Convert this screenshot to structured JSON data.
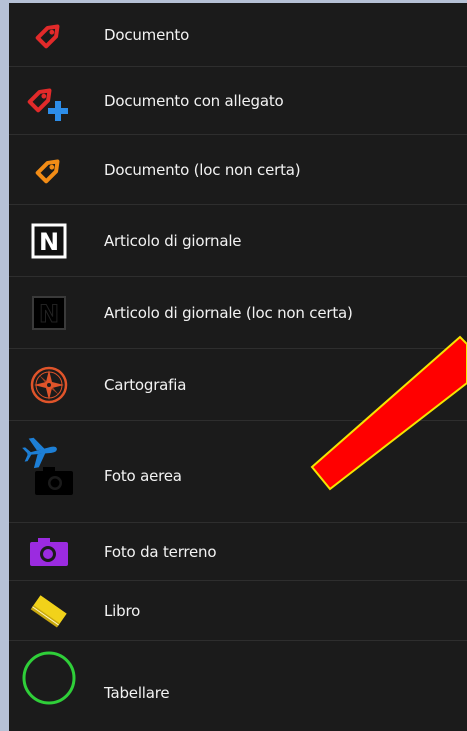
{
  "legend": {
    "items": [
      {
        "label": "Documento",
        "icon": "red-tag-icon",
        "color": "#e22a2a"
      },
      {
        "label": "Documento con allegato",
        "icon": "red-tag-plus-icon",
        "color": "#e22a2a"
      },
      {
        "label": "Documento (loc non certa)",
        "icon": "orange-tag-icon",
        "color": "#f28c16"
      },
      {
        "label": "Articolo di giornale",
        "icon": "newspaper-n-icon",
        "color": "#ffffff"
      },
      {
        "label": "Articolo di giornale (loc non certa)",
        "icon": "newspaper-n-dark-icon",
        "color": "#000000"
      },
      {
        "label": "Cartografia",
        "icon": "compass-rose-icon",
        "color": "#e0542a"
      },
      {
        "label": "Foto aerea",
        "icon": "airplane-camera-icon",
        "color": "#1d7fd6"
      },
      {
        "label": "Foto da terreno",
        "icon": "purple-camera-icon",
        "color": "#9b2be0"
      },
      {
        "label": "Libro",
        "icon": "yellow-book-icon",
        "color": "#f1d21a"
      },
      {
        "label": "Tabellare",
        "icon": "green-circle-icon",
        "color": "#2fcf39"
      }
    ]
  },
  "annotation": {
    "icon": "red-arrow-icon",
    "fill": "#ff0000",
    "stroke": "#f4e400"
  }
}
